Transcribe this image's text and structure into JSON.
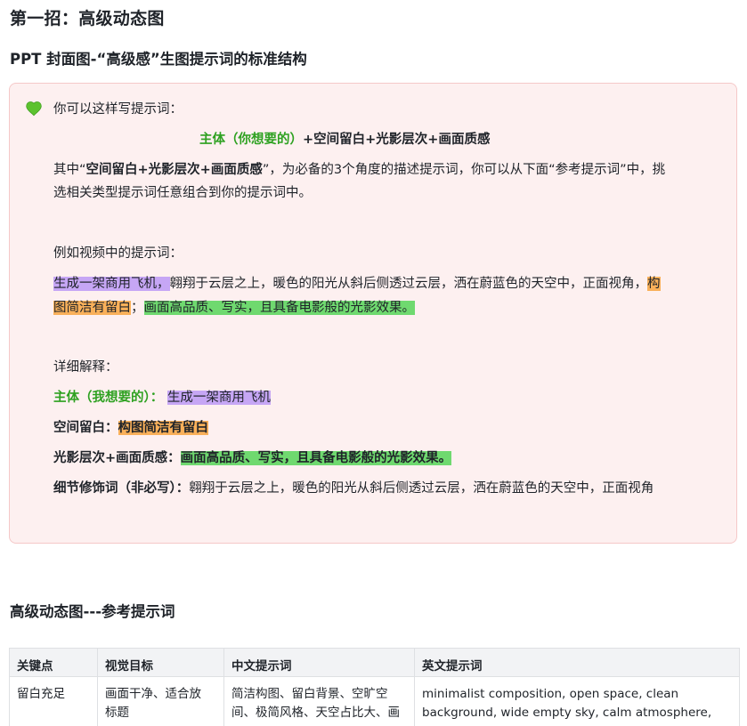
{
  "heading1": "第一招：高级动态图",
  "heading2": "PPT 封面图-“高级感”生图提示词的标准结构",
  "callout": {
    "icon": "green-heart-icon",
    "intro": "你可以这样写提示词：",
    "formula": {
      "subject": "主体（你想要的）",
      "rest": "+空间留白+光影层次+画面质感"
    },
    "explain": {
      "line1_a": "其中“",
      "line1_b": "空间留白+光影层次+画面质感",
      "line1_c": "”，为必备的3个角度的描述提示词，你可以从下面“参考提示词”中，挑",
      "line2": "选相关类型提示词任意组合到你的提示词中。"
    },
    "example_label": "例如视频中的提示词：",
    "example": {
      "subject": "生成一架商用飞机，",
      "detail": "翱翔于云层之上，暖色的阳光从斜后侧透过云层，洒在蔚蓝色的天空中，正面视角，",
      "space_a": "构",
      "space_b": "图简洁有留白",
      "sep": "；",
      "quality": "画面高品质、写实，且具备电影般的光影效果。"
    },
    "detail_label": "详细解释：",
    "details": {
      "subject_key": "主体（我想要的）：",
      "subject_val": "生成一架商用飞机",
      "space_key": "空间留白：",
      "space_val": "构图简洁有留白",
      "light_key": "光影层次+画面质感：",
      "light_val": "画面高品质、写实，且具备电影般的光影效果。",
      "modifier_key": "细节修饰词（非必写）：",
      "modifier_val": "翱翔于云层之上，暖色的阳光从斜后侧透过云层，洒在蔚蓝色的天空中，正面视角"
    }
  },
  "heading3": "高级动态图---参考提示词",
  "table": {
    "headers": [
      "关键点",
      "视觉目标",
      "中文提示词",
      "英文提示词"
    ],
    "rows": [
      {
        "key": "留白充足",
        "goal_l1": "画面干净、适合放",
        "goal_l2": "标题",
        "cn_l1": "简洁构图、留白背景、空旷空",
        "cn_l2": "间、极简风格、天空占比大、画",
        "en_l1": "minimalist composition, open space, clean",
        "en_l2": "background, wide empty sky, calm atmosphere,"
      }
    ]
  },
  "colors": {
    "purple_highlight": "#c6a6f5",
    "orange_highlight": "#f9b05a",
    "green_highlight": "#6fd96f",
    "green_text": "#2ea121",
    "callout_bg": "#fdf0f0"
  }
}
